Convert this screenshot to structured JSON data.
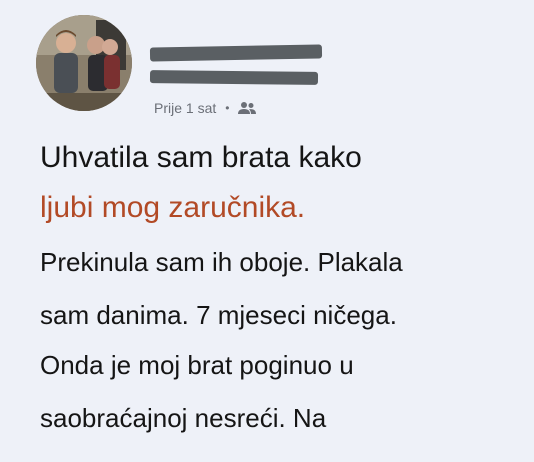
{
  "post": {
    "time": "Prije 1 sat",
    "separator": "•",
    "audience_icon": "people-icon",
    "headline": [
      "Uhvatila sam brata kako",
      "ljubi mog zaručnika."
    ],
    "body": [
      "Prekinula sam ih oboje. Plakala",
      "sam danima. 7 mjeseci ničega.",
      "Onda je moj brat poginuo u",
      "saobraćajnoj nesreći. Na",
      ""
    ]
  },
  "colors": {
    "background": "#eef1f8",
    "headline_accent": "#b24a26",
    "text": "#151515",
    "meta": "#6b6f77"
  }
}
